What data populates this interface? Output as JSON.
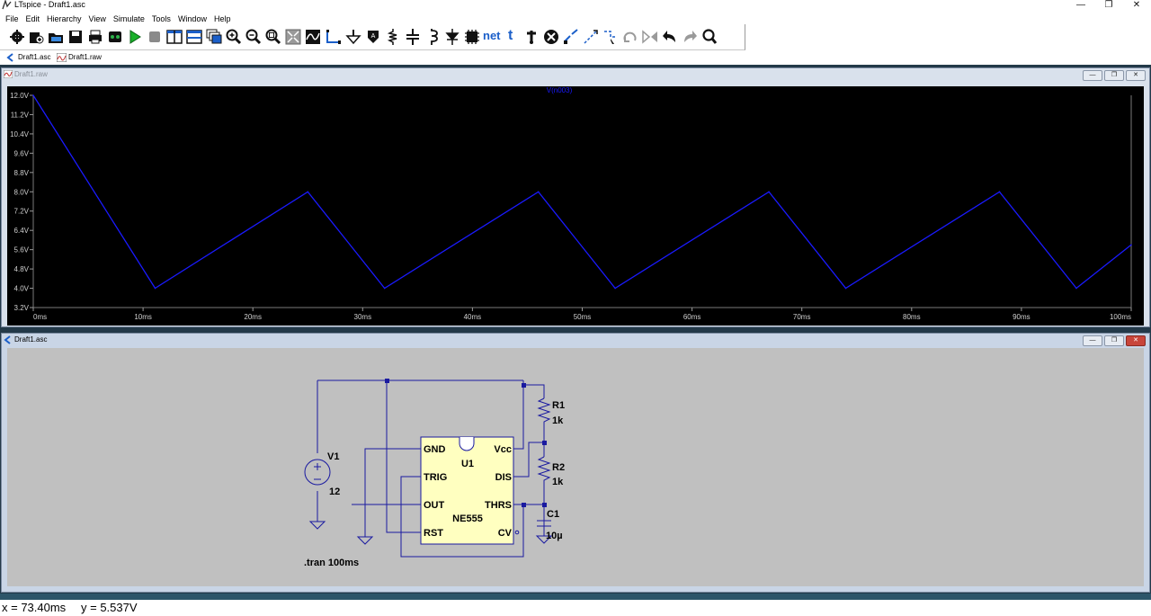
{
  "window": {
    "title": "LTspice - Draft1.asc",
    "controls": {
      "minimize": "—",
      "restore": "❐",
      "close": "✕"
    }
  },
  "menu": [
    "File",
    "Edit",
    "Hierarchy",
    "View",
    "Simulate",
    "Tools",
    "Window",
    "Help"
  ],
  "toolbar": {
    "icons": [
      "settings-icon",
      "new-schematic-icon",
      "open-icon",
      "save-icon",
      "print-icon",
      "control-panel-icon",
      "run-icon",
      "halt-icon",
      "tile-vertical-icon",
      "tile-horizontal-icon",
      "cascade-icon",
      "zoom-in-icon",
      "zoom-out-icon",
      "zoom-fit-icon",
      "zoom-full-icon",
      "autorange-icon",
      "wire-icon",
      "ground-icon",
      "label-net-icon",
      "resistor-icon",
      "capacitor-icon",
      "inductor-icon",
      "diode-icon",
      "component-icon",
      "net-label-icon",
      "text-icon",
      "spice-directive-icon",
      "delete-icon",
      "duplicate-icon",
      "move-icon",
      "drag-icon",
      "rotate-icon",
      "mirror-icon",
      "undo-icon",
      "redo-icon",
      "find-icon"
    ],
    "net_label": "net",
    "text_label": "t"
  },
  "tabs": [
    {
      "label": "Draft1.asc",
      "icon": "schematic-icon"
    },
    {
      "label": "Draft1.raw",
      "icon": "waveform-icon"
    }
  ],
  "waveform_window": {
    "title": "Draft1.raw",
    "trace_label": "V(n003)",
    "trace_color": "#1a1aff"
  },
  "chart_data": {
    "type": "line",
    "title": "",
    "xlabel": "",
    "ylabel": "",
    "xlim": [
      0,
      100
    ],
    "ylim": [
      3.2,
      12.0
    ],
    "x_ticks": [
      "0ms",
      "10ms",
      "20ms",
      "30ms",
      "40ms",
      "50ms",
      "60ms",
      "70ms",
      "80ms",
      "90ms",
      "100ms"
    ],
    "y_ticks": [
      "12.0V",
      "11.2V",
      "10.4V",
      "9.6V",
      "8.8V",
      "8.0V",
      "7.2V",
      "6.4V",
      "5.6V",
      "4.8V",
      "4.0V",
      "3.2V"
    ],
    "series": [
      {
        "name": "V(n003)",
        "x": [
          0,
          11.1,
          25.0,
          32.0,
          46.0,
          53.0,
          67.0,
          74.0,
          88.0,
          95.0,
          100.0
        ],
        "y": [
          12.0,
          4.0,
          8.0,
          4.0,
          8.0,
          4.0,
          8.0,
          4.0,
          8.0,
          4.0,
          5.8
        ]
      }
    ],
    "grid": false,
    "legend": "top-center"
  },
  "schematic_window": {
    "title": "Draft1.asc",
    "components": {
      "v1": {
        "name": "V1",
        "value": "12"
      },
      "r1": {
        "name": "R1",
        "value": "1k"
      },
      "r2": {
        "name": "R2",
        "value": "1k"
      },
      "c1": {
        "name": "C1",
        "value": "10µ"
      },
      "u1": {
        "name": "U1",
        "model": "NE555",
        "pins": {
          "gnd": "GND",
          "trig": "TRIG",
          "out": "OUT",
          "rst": "RST",
          "vcc": "Vcc",
          "dis": "DIS",
          "thrs": "THRS",
          "cv": "CV"
        }
      }
    },
    "directive": ".tran 100ms",
    "wire_color": "#1a1aa0",
    "component_fill": "#ffffc0"
  },
  "status": {
    "x": "x = 73.40ms",
    "y": "y = 5.537V"
  }
}
